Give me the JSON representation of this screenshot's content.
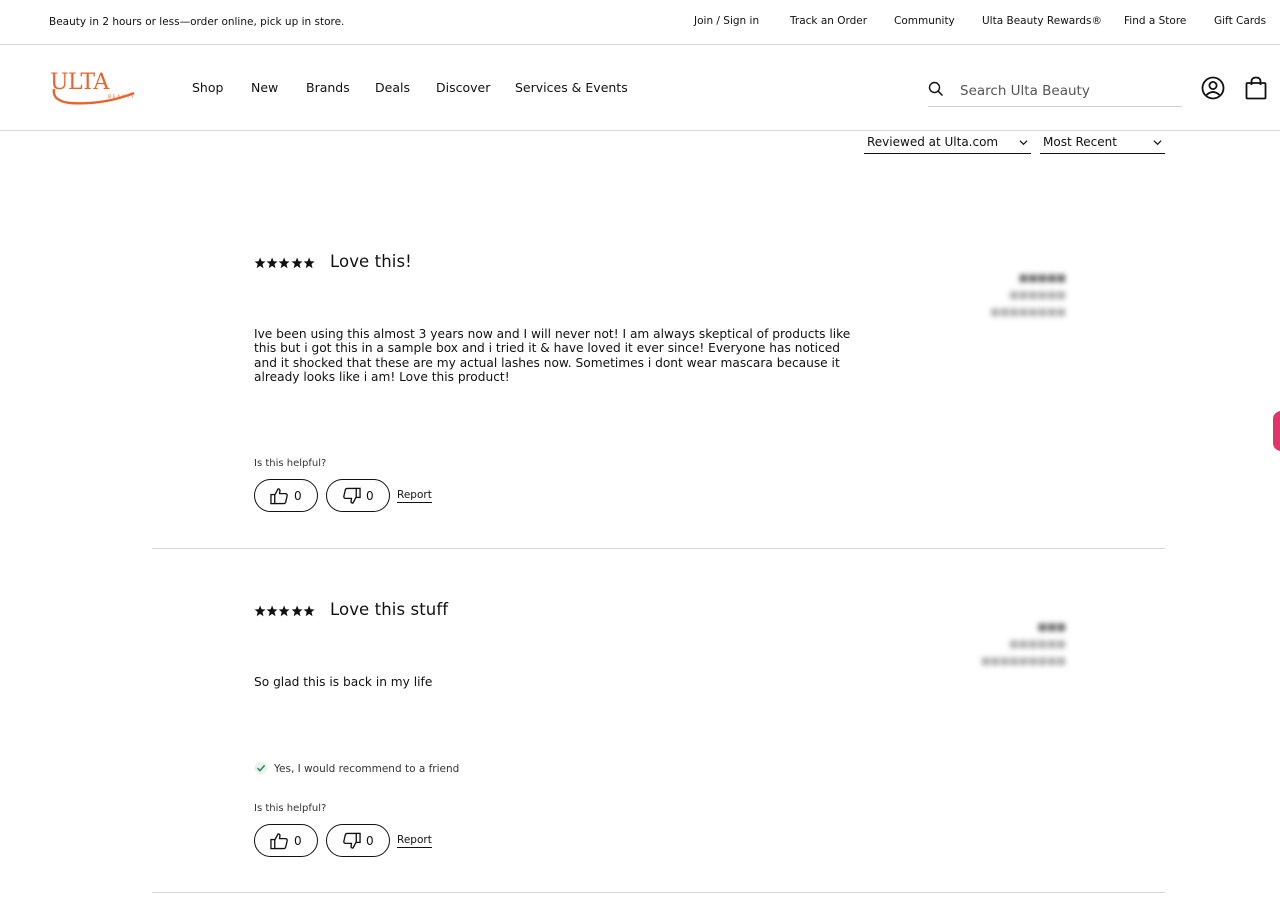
{
  "topbar": {
    "promo": "Beauty in 2 hours or less—order online, pick up in store.",
    "links": [
      "Join / Sign in",
      "Track an Order",
      "Community",
      "Ulta Beauty Rewards®",
      "Find a Store",
      "Gift Cards"
    ]
  },
  "header": {
    "logo_text": "ULTA",
    "logo_subtext": "BEAUTY",
    "nav": [
      "Shop",
      "New",
      "Brands",
      "Deals",
      "Discover",
      "Services & Events"
    ],
    "search_placeholder": "Search Ulta Beauty"
  },
  "filters": {
    "source": "Reviewed at Ulta.com",
    "sort": "Most Recent"
  },
  "reviews": [
    {
      "rating": 5,
      "title": "Love this!",
      "body": "Ive been using this almost 3 years now and I will never not! I am always skeptical of products like this but i got this in a sample box and i tried it & have loved it ever since! Everyone has noticed and it shocked that these are my actual lashes now. Sometimes i dont wear mascara because it already looks like i am! Love this product!",
      "helpful_label": "Is this helpful?",
      "upvotes": "0",
      "downvotes": "0",
      "report_label": "Report"
    },
    {
      "rating": 5,
      "title": "Love this stuff",
      "body": "So glad this is back in my life",
      "recommend": "Yes, I would recommend to a friend",
      "helpful_label": "Is this helpful?",
      "upvotes": "0",
      "downvotes": "0",
      "report_label": "Report"
    }
  ],
  "colors": {
    "brand_orange": "#e8642c",
    "accent_pink": "#e2336b",
    "recommend_check": "#2e8b57"
  }
}
